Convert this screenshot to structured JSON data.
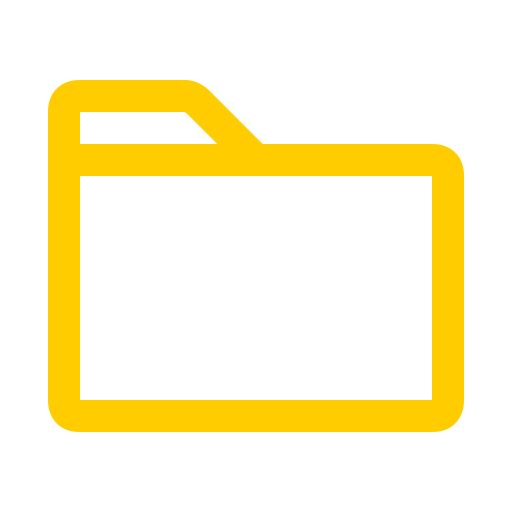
{
  "icon": {
    "name": "folder-icon",
    "color": "#FFCC00",
    "background": "#FFFFFF"
  }
}
